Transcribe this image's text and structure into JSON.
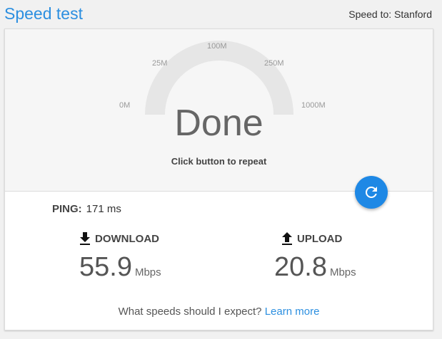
{
  "header": {
    "title": "Speed test",
    "speed_to": "Speed to: Stanford"
  },
  "gauge": {
    "ticks": [
      "0M",
      "25M",
      "100M",
      "250M",
      "1000M"
    ],
    "status": "Done",
    "hint": "Click button to repeat",
    "arc_color": "#e6e6e6"
  },
  "results": {
    "ping_label": "PING:",
    "ping_value": "171 ms",
    "download": {
      "label": "DOWNLOAD",
      "value": "55.9",
      "unit": "Mbps"
    },
    "upload": {
      "label": "UPLOAD",
      "value": "20.8",
      "unit": "Mbps"
    }
  },
  "footer": {
    "question": "What speeds should I expect?",
    "link": "Learn more"
  },
  "icons": {
    "repeat": "refresh-icon",
    "download": "download-icon",
    "upload": "upload-icon"
  },
  "colors": {
    "accent": "#2c8fe0",
    "button": "#1e88e5"
  }
}
